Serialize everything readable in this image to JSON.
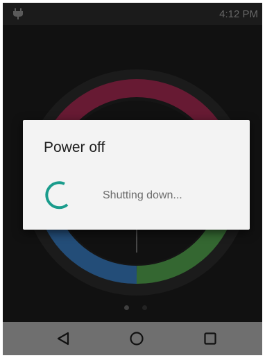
{
  "status_bar": {
    "time": "4:12 PM",
    "charging_icon": "plug-icon"
  },
  "dialog": {
    "title": "Power off",
    "message": "Shutting down...",
    "spinner_icon": "progress-spinner-icon",
    "accent_color": "#1a9c8c"
  },
  "background": {
    "wheel_colors": [
      "#7a1f3d",
      "#2a5b8d",
      "#3e7a3a"
    ],
    "page_indicator": {
      "pages": 2,
      "current": 1
    }
  },
  "nav_bar": {
    "back_icon": "back-triangle-icon",
    "home_icon": "home-circle-icon",
    "recents_icon": "recents-square-icon"
  }
}
